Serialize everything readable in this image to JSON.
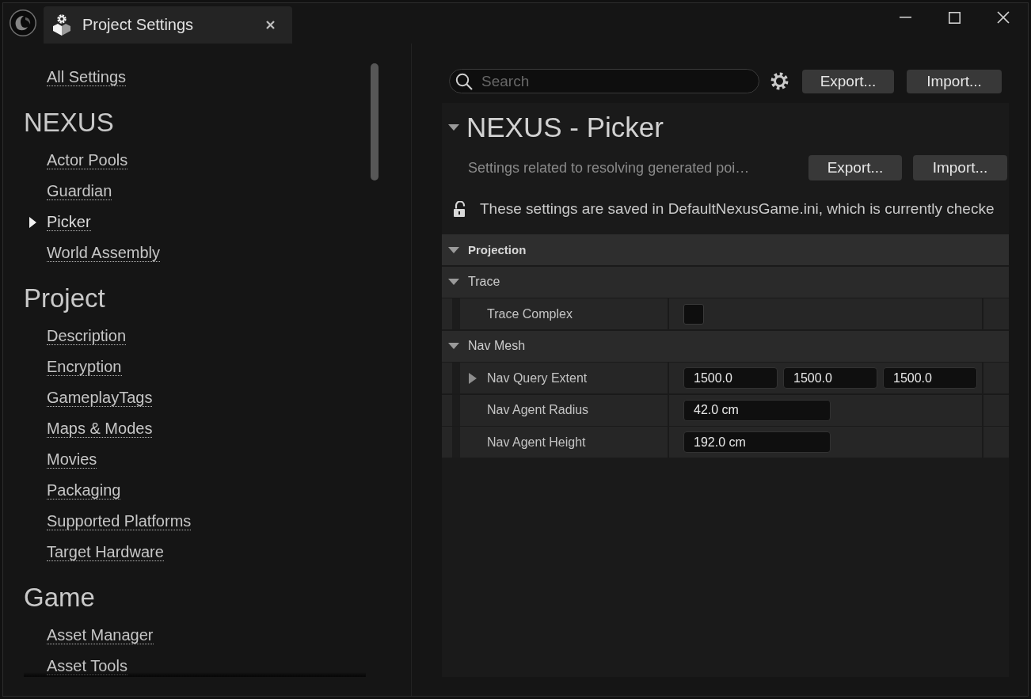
{
  "tab": {
    "title": "Project Settings"
  },
  "sidebar": {
    "all_settings": {
      "label": "All Settings",
      "selected": false
    },
    "sections": [
      {
        "heading": "NEXUS",
        "items": [
          {
            "label": "Actor Pools",
            "selected": false
          },
          {
            "label": "Guardian",
            "selected": false
          },
          {
            "label": "Picker",
            "selected": true
          },
          {
            "label": "World Assembly",
            "selected": false
          }
        ]
      },
      {
        "heading": "Project",
        "items": [
          {
            "label": "Description",
            "selected": false
          },
          {
            "label": "Encryption",
            "selected": false
          },
          {
            "label": "GameplayTags",
            "selected": false
          },
          {
            "label": "Maps & Modes",
            "selected": false
          },
          {
            "label": "Movies",
            "selected": false
          },
          {
            "label": "Packaging",
            "selected": false
          },
          {
            "label": "Supported Platforms",
            "selected": false
          },
          {
            "label": "Target Hardware",
            "selected": false
          }
        ]
      },
      {
        "heading": "Game",
        "items": [
          {
            "label": "Asset Manager",
            "selected": false
          },
          {
            "label": "Asset Tools",
            "selected": false
          }
        ]
      }
    ]
  },
  "toolbar": {
    "search": {
      "placeholder": "Search"
    },
    "buttons": [
      "Export...",
      "Import..."
    ]
  },
  "details": {
    "section": {
      "title": "NEXUS - Picker",
      "expanded": true,
      "description": "Settings related to resolving generated poi…",
      "buttons": [
        "Export...",
        "Import..."
      ],
      "notice": {
        "text": "These settings are saved in DefaultNexusGame.ini, which is currently checke",
        "locked": false
      }
    },
    "categories": [
      {
        "kind": "category",
        "name": "Projection",
        "expanded": true,
        "children": [
          {
            "kind": "group",
            "name": "Trace",
            "expanded": true,
            "children": [
              {
                "kind": "checkbox",
                "name": "Trace Complex",
                "checked": false
              }
            ]
          },
          {
            "kind": "group",
            "name": "Nav Mesh",
            "expanded": true,
            "children": [
              {
                "kind": "vector",
                "name": "Nav Query Extent",
                "expanded": false,
                "values": [
                  "1500.0",
                  "1500.0",
                  "1500.0"
                ]
              },
              {
                "kind": "number",
                "name": "Nav Agent Radius",
                "value": "42.0 cm"
              },
              {
                "kind": "number",
                "name": "Nav Agent Height",
                "value": "192.0 cm"
              }
            ]
          }
        ]
      }
    ]
  }
}
